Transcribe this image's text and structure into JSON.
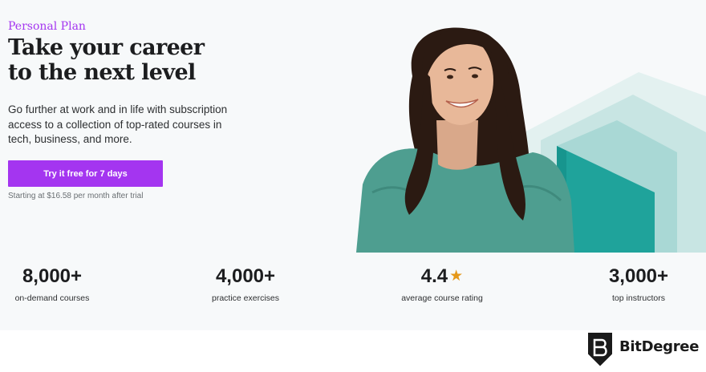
{
  "hero": {
    "eyebrow": "Personal Plan",
    "headline": "Take your career\nto the next level",
    "description": "Go further at work and in life with subscription access to a collection of top-rated courses in tech, business, and more.",
    "cta_label": "Try it free for 7 days",
    "fineprint": "Starting at $16.58 per month after trial"
  },
  "stats": [
    {
      "value": "8,000+",
      "label": "on-demand courses"
    },
    {
      "value": "4,000+",
      "label": "practice exercises"
    },
    {
      "value": "4.4",
      "label": "average course rating",
      "icon": "star-icon"
    },
    {
      "value": "3,000+",
      "label": "top instructors"
    }
  ],
  "watermark": {
    "brand": "BitDegree"
  },
  "colors": {
    "accent": "#a435f0",
    "star": "#e59819",
    "teal": "#1fa39b",
    "hero_bg": "#f7f9fa"
  }
}
